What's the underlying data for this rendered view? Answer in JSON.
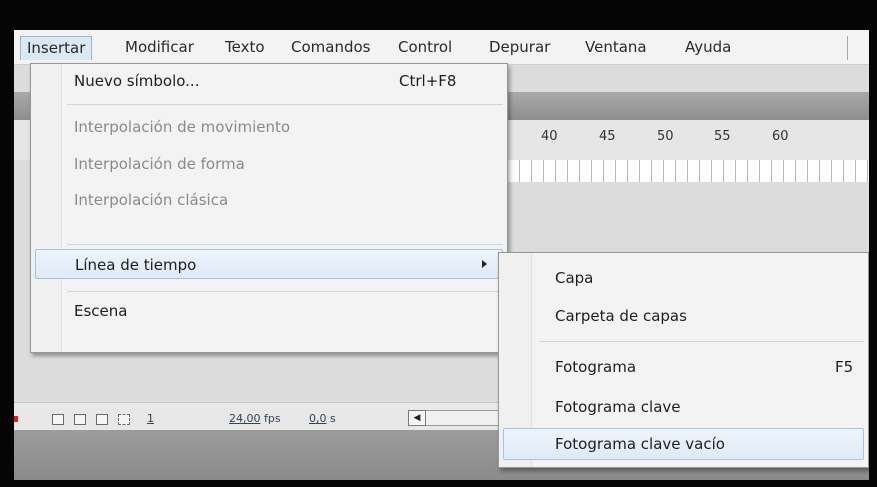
{
  "menubar": {
    "items": [
      "Insertar",
      "Modificar",
      "Texto",
      "Comandos",
      "Control",
      "Depurar",
      "Ventana",
      "Ayuda"
    ]
  },
  "timeline": {
    "ruler_labels": [
      "40",
      "45",
      "50",
      "55",
      "60"
    ],
    "status": {
      "frame": "1",
      "fps_value": "24,00",
      "fps_unit": "fps",
      "time_value": "0,0",
      "time_unit": "s"
    }
  },
  "insert_menu": {
    "new_symbol": {
      "label": "Nuevo símbolo...",
      "shortcut": "Ctrl+F8"
    },
    "motion_tween": {
      "label": "Interpolación de movimiento"
    },
    "shape_tween": {
      "label": "Interpolación de forma"
    },
    "classic_tween": {
      "label": "Interpolación clásica"
    },
    "timeline": {
      "label": "Línea de tiempo"
    },
    "scene": {
      "label": "Escena"
    }
  },
  "timeline_submenu": {
    "layer": {
      "label": "Capa"
    },
    "layer_folder": {
      "label": "Carpeta de capas"
    },
    "frame": {
      "label": "Fotograma",
      "shortcut": "F5"
    },
    "keyframe": {
      "label": "Fotograma clave"
    },
    "blank_keyframe": {
      "label": "Fotograma clave vacío"
    }
  },
  "icons": {
    "submenu": "chevron-right-icon",
    "scroll_left": "arrow-left-icon"
  },
  "colors": {
    "highlight_border": "#a7c2e4",
    "highlight_fill": "#dfeaf7",
    "disabled_text": "#8a8a8a",
    "frame_border": "#050505"
  }
}
